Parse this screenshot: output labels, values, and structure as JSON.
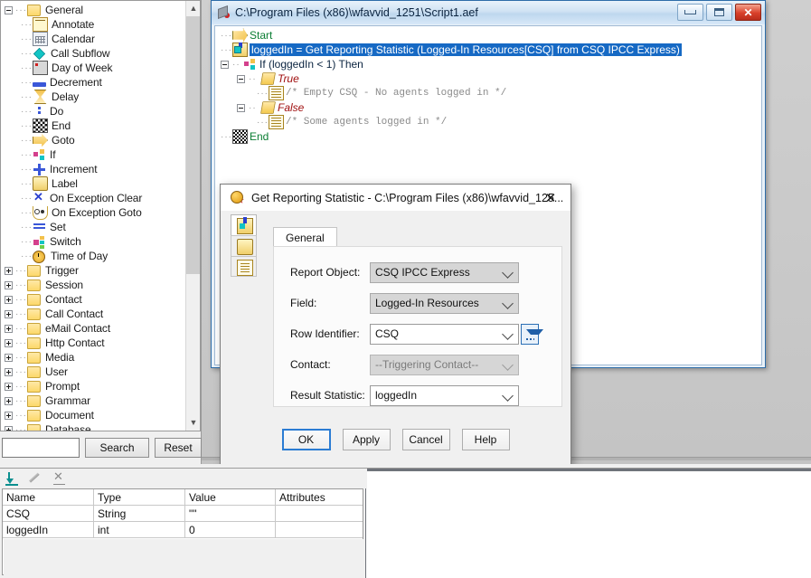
{
  "palette": {
    "root": {
      "label": "General",
      "expanded": true
    },
    "items": [
      {
        "label": "Annotate",
        "icon": "annotate-icon"
      },
      {
        "label": "Calendar",
        "icon": "calendar-icon"
      },
      {
        "label": "Call Subflow",
        "icon": "call-subflow-icon"
      },
      {
        "label": "Day of Week",
        "icon": "day-of-week-icon"
      },
      {
        "label": "Decrement",
        "icon": "decrement-icon"
      },
      {
        "label": "Delay",
        "icon": "delay-icon"
      },
      {
        "label": "Do",
        "icon": "do-icon"
      },
      {
        "label": "End",
        "icon": "end-icon"
      },
      {
        "label": "Goto",
        "icon": "goto-icon"
      },
      {
        "label": "If",
        "icon": "if-icon"
      },
      {
        "label": "Increment",
        "icon": "increment-icon"
      },
      {
        "label": "Label",
        "icon": "label-icon"
      },
      {
        "label": "On Exception Clear",
        "icon": "on-exception-clear-icon"
      },
      {
        "label": "On Exception Goto",
        "icon": "on-exception-goto-icon"
      },
      {
        "label": "Set",
        "icon": "set-icon"
      },
      {
        "label": "Switch",
        "icon": "switch-icon"
      },
      {
        "label": "Time of Day",
        "icon": "time-of-day-icon"
      }
    ],
    "folders": [
      {
        "label": "Trigger"
      },
      {
        "label": "Session"
      },
      {
        "label": "Contact"
      },
      {
        "label": "Call Contact"
      },
      {
        "label": "eMail Contact"
      },
      {
        "label": "Http Contact"
      },
      {
        "label": "Media"
      },
      {
        "label": "User"
      },
      {
        "label": "Prompt"
      },
      {
        "label": "Grammar"
      },
      {
        "label": "Document"
      },
      {
        "label": "Database"
      }
    ],
    "search": {
      "value": "",
      "placeholder": "",
      "search_label": "Search",
      "reset_label": "Reset"
    }
  },
  "script_window": {
    "title": "C:\\Program Files (x86)\\wfavvid_1251\\Script1.aef",
    "minimize_label": "Minimize",
    "maximize_label": "Maximize",
    "close_label": "✕",
    "rows": [
      {
        "text": "Start",
        "style": "green",
        "icon": "start-icon"
      },
      {
        "text": "loggedIn = Get Reporting Statistic (Logged-In Resources[CSQ] from CSQ IPCC Express)",
        "style": "selected",
        "icon": "get-reporting-statistic-icon"
      },
      {
        "text": "If (loggedIn < 1) Then",
        "style": "blue",
        "icon": "if-icon"
      },
      {
        "text": "True",
        "style": "red-italic",
        "icon": "branch-folder-icon"
      },
      {
        "text": "/* Empty CSQ - No agents logged in */",
        "style": "comment",
        "icon": "annotate-icon"
      },
      {
        "text": "False",
        "style": "red-italic",
        "icon": "branch-folder-icon"
      },
      {
        "text": "/* Some agents logged in */",
        "style": "comment",
        "icon": "annotate-icon"
      },
      {
        "text": "End",
        "style": "green",
        "icon": "end-icon"
      }
    ]
  },
  "dialog": {
    "title": "Get Reporting Statistic - C:\\Program Files (x86)\\wfavvid_125...",
    "close_label": "✕",
    "side_tabs": [
      {
        "name": "general-tab-icon"
      },
      {
        "name": "label-tab-icon"
      },
      {
        "name": "document-tab-icon"
      }
    ],
    "tab": "General",
    "fields": [
      {
        "label": "Report Object:",
        "value": "CSQ IPCC Express",
        "state": "gray"
      },
      {
        "label": "Field:",
        "value": "Logged-In Resources",
        "state": "gray"
      },
      {
        "label": "Row Identifier:",
        "value": "CSQ",
        "state": "editable",
        "picker": true
      },
      {
        "label": "Contact:",
        "value": "--Triggering Contact--",
        "state": "disabled"
      },
      {
        "label": "Result Statistic:",
        "value": "loggedIn",
        "state": "editable"
      }
    ],
    "buttons": [
      {
        "label": "OK",
        "default": true
      },
      {
        "label": "Apply",
        "default": false
      },
      {
        "label": "Cancel",
        "default": false
      },
      {
        "label": "Help",
        "default": false
      }
    ]
  },
  "variables": {
    "toolbar": [
      {
        "name": "add-variable-icon"
      },
      {
        "name": "edit-variable-icon"
      },
      {
        "name": "delete-variable-icon"
      }
    ],
    "columns": [
      "Name",
      "Type",
      "Value",
      "Attributes"
    ],
    "rows": [
      {
        "name": "CSQ",
        "type": "String",
        "value": "\"\"",
        "attributes": ""
      },
      {
        "name": "loggedIn",
        "type": "int",
        "value": "0",
        "attributes": ""
      }
    ]
  },
  "colors": {
    "selection": "#1669c4",
    "title_accent": "#2d6ca8",
    "close_button": "#d9402a"
  }
}
